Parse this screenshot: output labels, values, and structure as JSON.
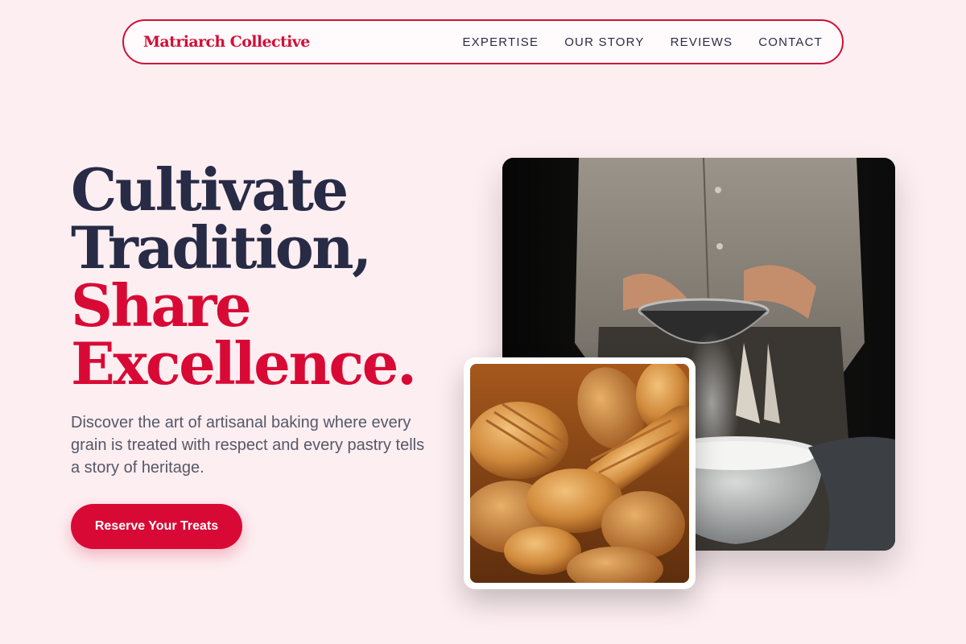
{
  "brand": {
    "name": "Matriarch Collective"
  },
  "nav": {
    "items": [
      "EXPERTISE",
      "OUR STORY",
      "REVIEWS",
      "CONTACT"
    ]
  },
  "hero": {
    "line1": "Cultivate",
    "line2": "Tradition,",
    "line3": "Share",
    "line4": "Excellence.",
    "description": "Discover the art of artisanal baking where every grain is treated with respect and every pastry tells a story of heritage.",
    "cta_label": "Reserve Your Treats"
  },
  "images": {
    "main": "baker-sifting-flour-photo",
    "secondary": "assorted-bread-loaves-photo"
  },
  "colors": {
    "accent": "#d80a35",
    "dark_text": "#282b45",
    "background": "#fdeef1"
  }
}
